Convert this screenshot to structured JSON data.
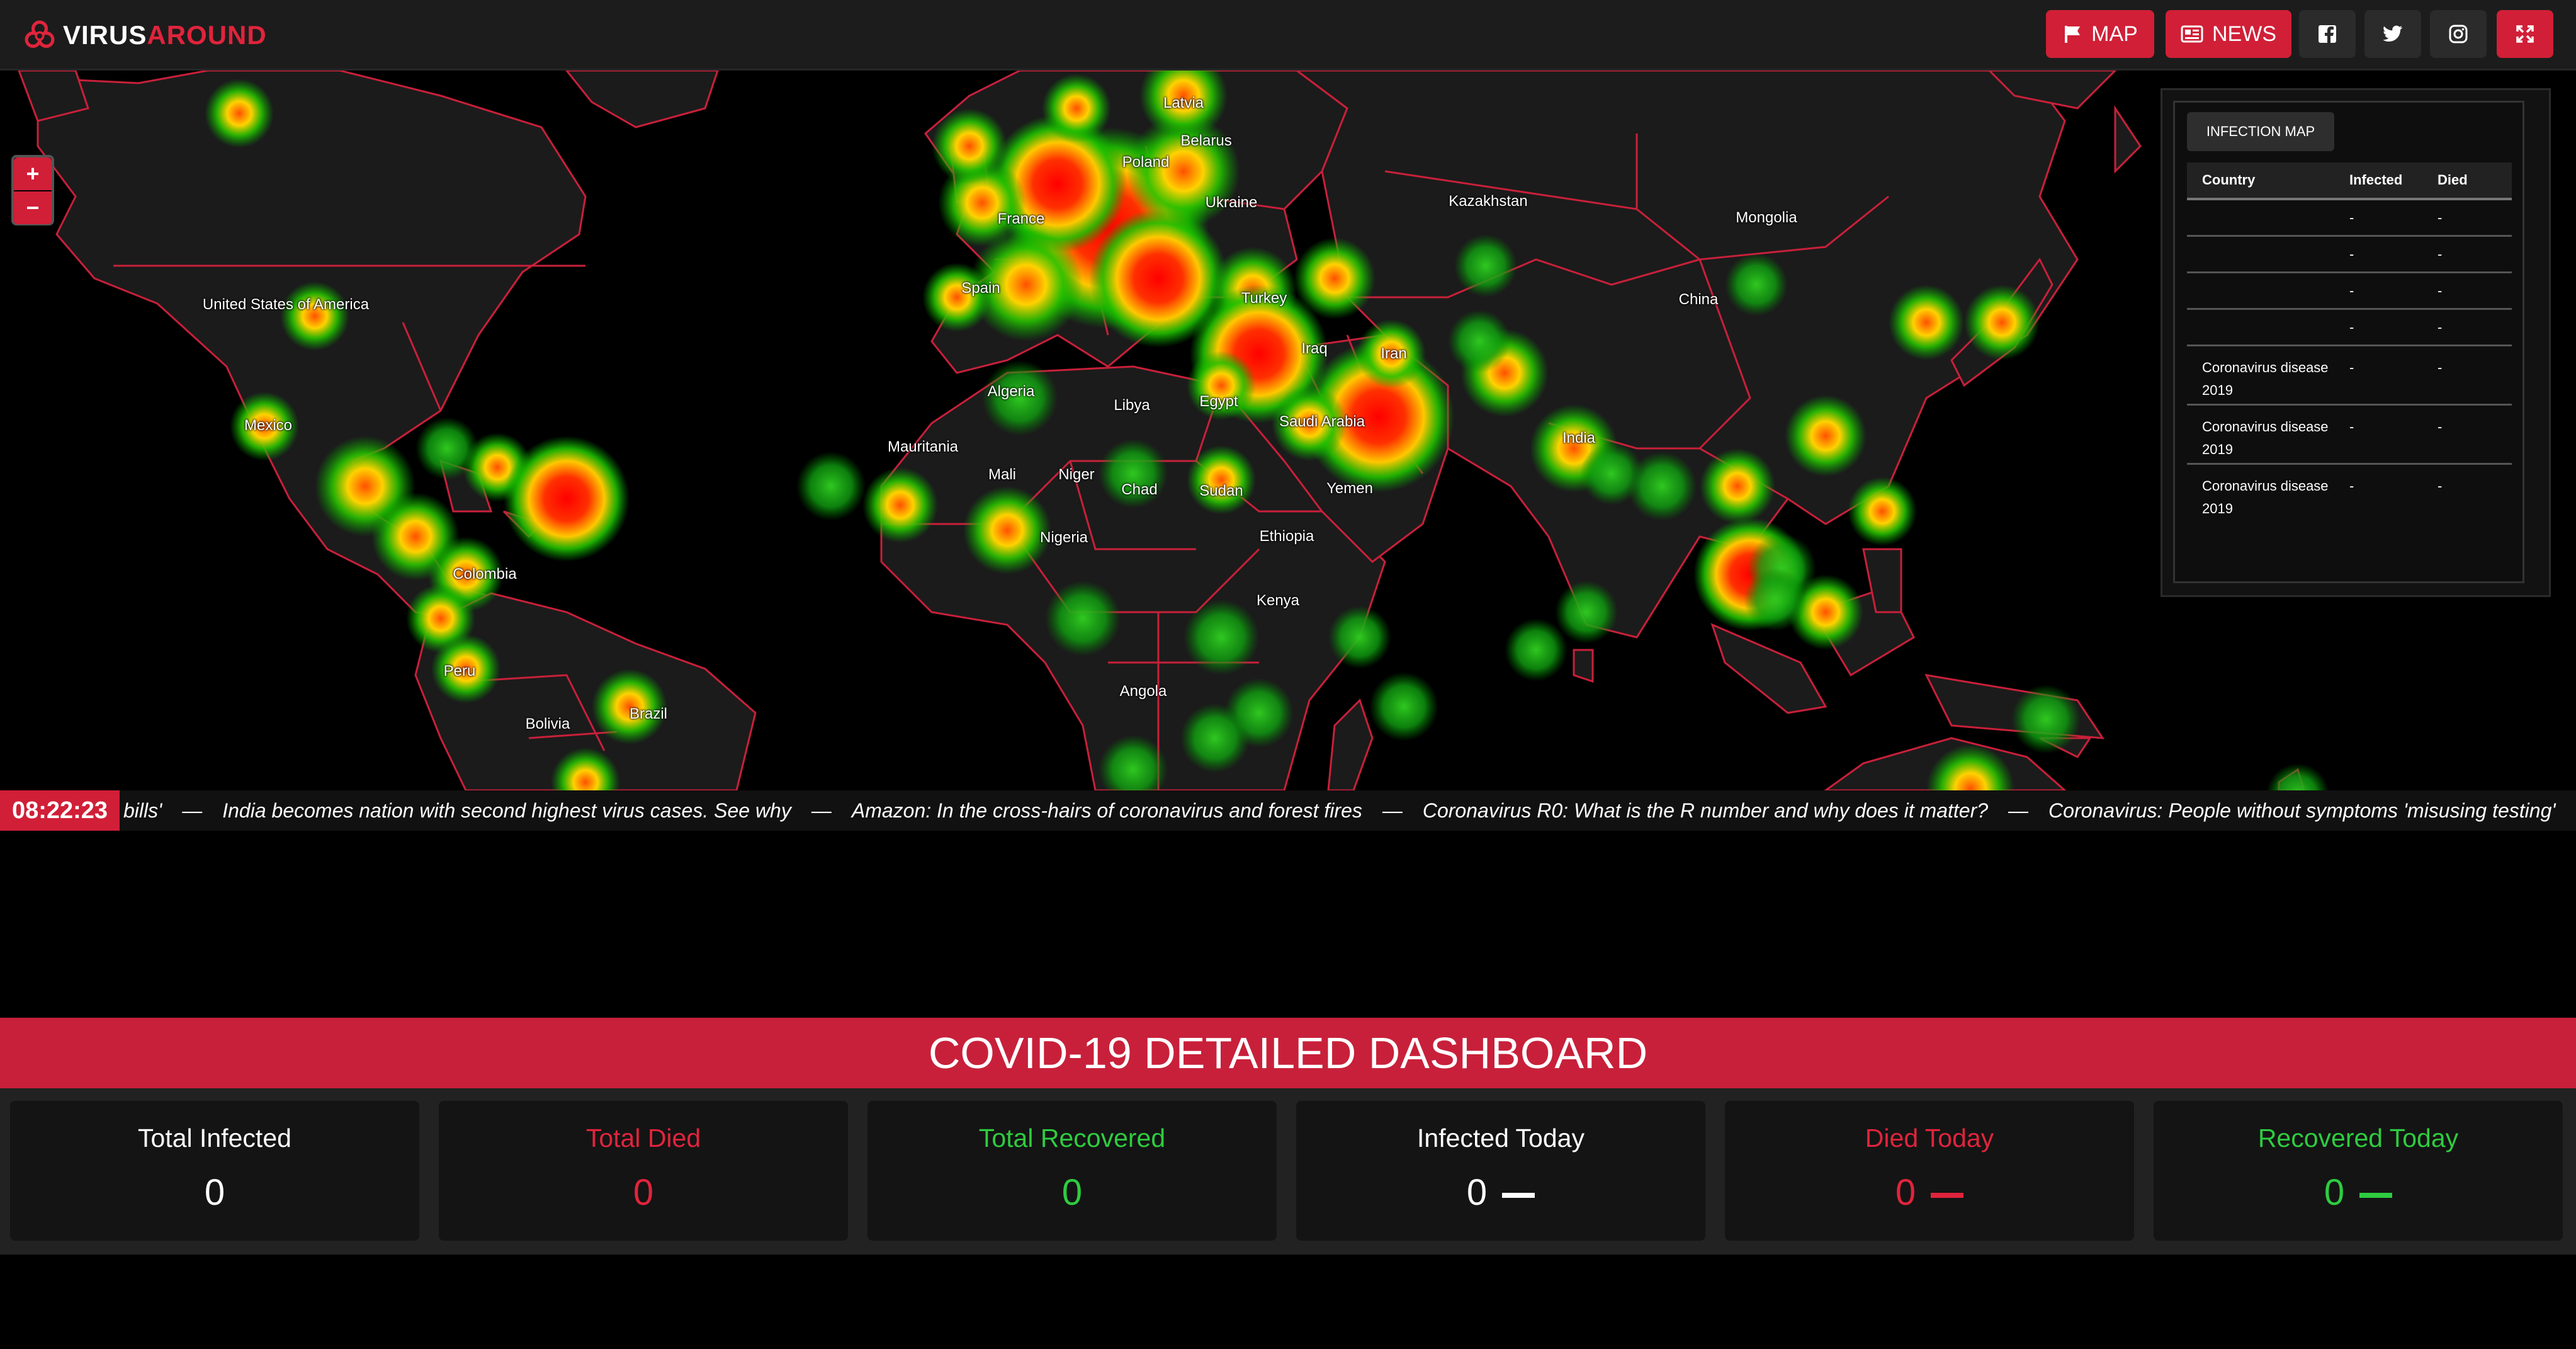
{
  "brand": {
    "name_part1": "VIRUS",
    "name_part2": "AROUND"
  },
  "nav": {
    "map_label": "MAP",
    "news_label": "NEWS",
    "social": [
      "facebook-icon",
      "twitter-icon",
      "instagram-icon"
    ],
    "fullscreen_icon": "expand-icon"
  },
  "map": {
    "zoom_in": "+",
    "zoom_out": "−",
    "country_labels": [
      "Latvia",
      "Belarus",
      "Poland",
      "Ukraine",
      "France",
      "Spain",
      "Turkey",
      "Iraq",
      "Iran",
      "Kazakhstan",
      "Mongolia",
      "China",
      "United States of America",
      "Mexico",
      "Colombia",
      "Peru",
      "Bolivia",
      "Brazil",
      "Algeria",
      "Libya",
      "Egypt",
      "Mauritania",
      "Mali",
      "Niger",
      "Chad",
      "Sudan",
      "Saudi Arabia",
      "Yemen",
      "Nigeria",
      "Ethiopia",
      "Kenya",
      "Angola",
      "India"
    ]
  },
  "infection_panel": {
    "tab": "INFECTION MAP",
    "columns": [
      "Country",
      "Infected",
      "Died"
    ],
    "rows": [
      {
        "country": "",
        "infected": "-",
        "died": "-"
      },
      {
        "country": "",
        "infected": "-",
        "died": "-"
      },
      {
        "country": "",
        "infected": "-",
        "died": "-"
      },
      {
        "country": "",
        "infected": "-",
        "died": "-"
      },
      {
        "country": "Coronavirus disease 2019",
        "infected": "-",
        "died": "-"
      },
      {
        "country": "Coronavirus disease 2019",
        "infected": "-",
        "died": "-"
      },
      {
        "country": "Coronavirus disease 2019",
        "infected": "-",
        "died": "-"
      }
    ]
  },
  "ticker": {
    "time": "08:22:23",
    "items": [
      "bills'",
      "India becomes nation with second highest virus cases. See why",
      "Amazon: In the cross-hairs of coronavirus and forest fires",
      "Coronavirus R0: What is the R number and why does it matter?",
      "Coronavirus: People without symptoms 'misusing testing'"
    ],
    "separator": "—"
  },
  "dashboard": {
    "title": "COVID-19 DETAILED DASHBOARD",
    "cards": [
      {
        "title": "Total Infected",
        "value": "0",
        "color": "#ffffff"
      },
      {
        "title": "Total Died",
        "value": "0",
        "color": "#e0243c"
      },
      {
        "title": "Total Recovered",
        "value": "0",
        "color": "#2ecc40"
      },
      {
        "title": "Infected Today",
        "value": "0",
        "color": "#ffffff"
      },
      {
        "title": "Died Today",
        "value": "0",
        "color": "#e0243c"
      },
      {
        "title": "Recovered Today",
        "value": "0",
        "color": "#2ecc40"
      }
    ]
  },
  "colors": {
    "accent": "#d11f37",
    "border": "#c8203a",
    "heat_high": "#ff0000",
    "heat_mid": "#ffd700",
    "heat_low": "#00c000"
  }
}
